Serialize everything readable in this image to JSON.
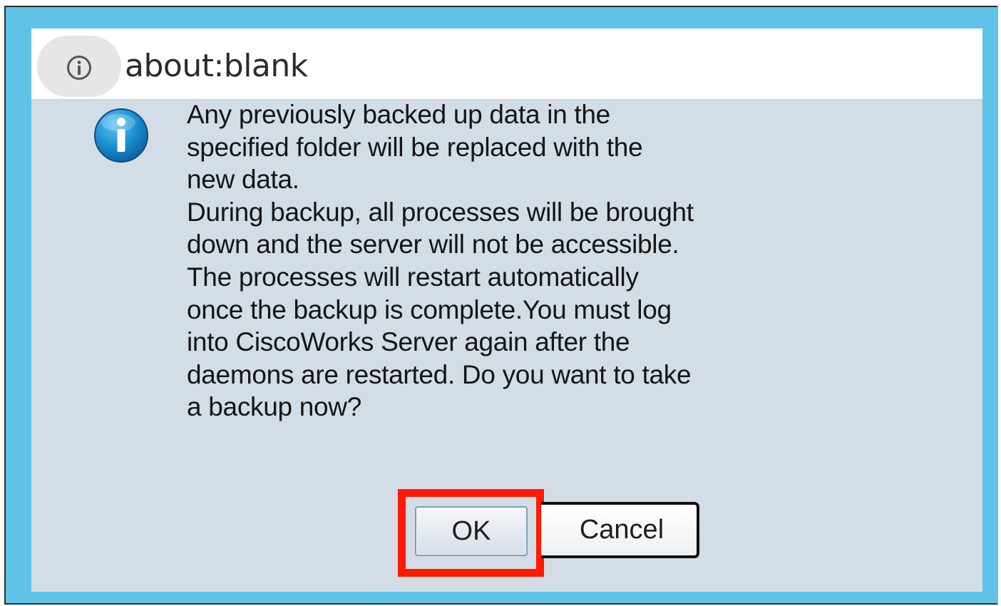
{
  "address_bar": {
    "url": "about:blank",
    "site_info_icon": "info-circle-icon"
  },
  "dialog": {
    "icon": "information-icon",
    "message": "Any previously backed up data in the\nspecified folder will be replaced with the\nnew data.\nDuring backup, all processes will be brought\ndown and the server will not be accessible.\nThe processes will restart automatically\nonce the backup is complete.You must log\ninto CiscoWorks Server again after the\ndaemons are restarted. Do you want to take\na backup now?",
    "ok_label": "OK",
    "cancel_label": "Cancel"
  },
  "colors": {
    "frame": "#5ec3e6",
    "dialog_background": "#d3dde6",
    "highlight": "#ff1a00",
    "info_badge": "#1a8fd0"
  }
}
